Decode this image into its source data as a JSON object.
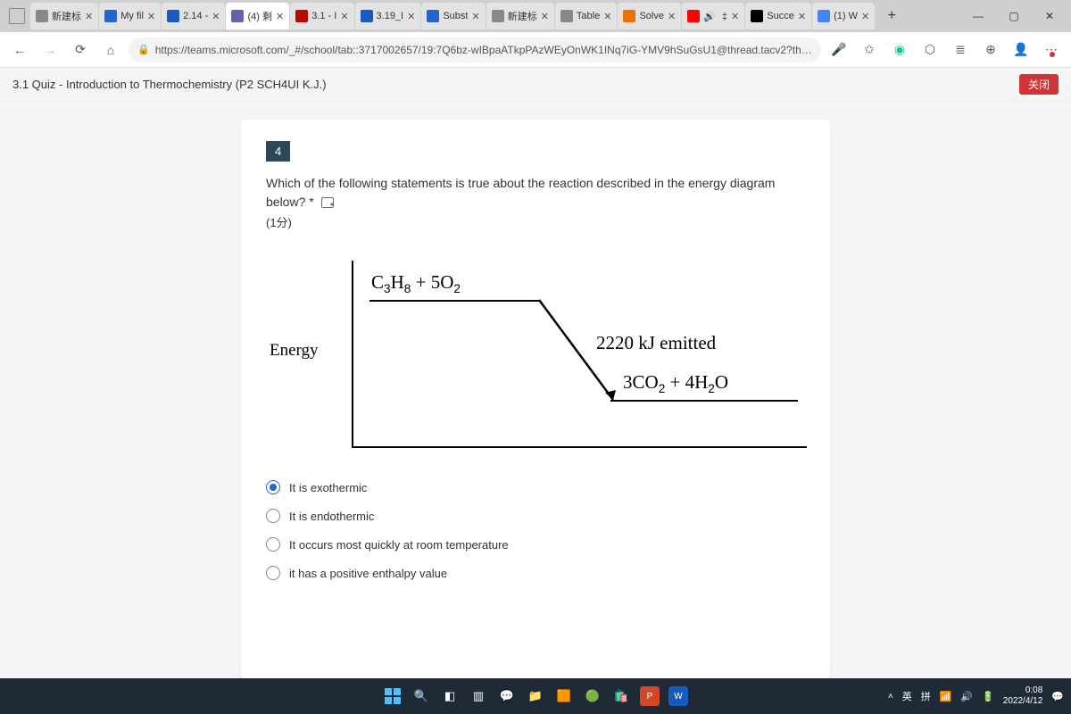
{
  "browser": {
    "tabs": [
      {
        "title": "新建标",
        "favicon_color": "#888"
      },
      {
        "title": "My fil",
        "favicon_color": "#2564cf"
      },
      {
        "title": "2.14 -",
        "favicon_color": "#185abd"
      },
      {
        "title": "(4) 剩",
        "favicon_color": "#6264a7",
        "active": true
      },
      {
        "title": "3.1 - I",
        "favicon_color": "#b30b00"
      },
      {
        "title": "3.19_I",
        "favicon_color": "#185abd"
      },
      {
        "title": "Subst",
        "favicon_color": "#2564cf"
      },
      {
        "title": "新建标",
        "favicon_color": "#888"
      },
      {
        "title": "Table",
        "favicon_color": "#888"
      },
      {
        "title": "Solve",
        "favicon_color": "#eb7100"
      },
      {
        "title": "🔊   ‡",
        "favicon_color": "#ff0000"
      },
      {
        "title": "Succe",
        "favicon_color": "#000"
      },
      {
        "title": "(1) W",
        "favicon_color": "#4285f4"
      }
    ],
    "url": "https://teams.microsoft.com/_#/school/tab::3717002657/19:7Q6bz-wIBpaATkpPAzWEyOnWK1INq7iG-YMV9hSuGsU1@thread.tacv2?threadId=1..."
  },
  "quiz": {
    "header_title": "3.1 Quiz - Introduction to Thermochemistry (P2 SCH4UI K.J.)",
    "close_label": "关闭",
    "question_number": "4",
    "question_text": "Which of the following statements is true about the reaction described in the energy diagram below? *",
    "points_text": "(1分)",
    "yaxis": "Energy",
    "reactant": "C₃H₈ + 5O₂",
    "emitted": "2220 kJ emitted",
    "product": "3CO₂ + 4H₂O",
    "options": [
      {
        "label": "It is exothermic",
        "selected": true
      },
      {
        "label": "It is endothermic",
        "selected": false
      },
      {
        "label": "It occurs most quickly at room temperature",
        "selected": false
      },
      {
        "label": "it has a positive enthalpy value",
        "selected": false
      }
    ]
  },
  "taskbar": {
    "ime1": "英",
    "ime2": "拼",
    "time": "0:08",
    "date": "2022/4/12"
  },
  "chart_data": {
    "type": "energy-diagram",
    "y_axis_label": "Energy",
    "reactants": "C3H8 + 5O2",
    "products": "3CO2 + 4H2O",
    "energy_change_kJ": -2220,
    "annotation": "2220 kJ emitted",
    "direction": "exothermic"
  }
}
